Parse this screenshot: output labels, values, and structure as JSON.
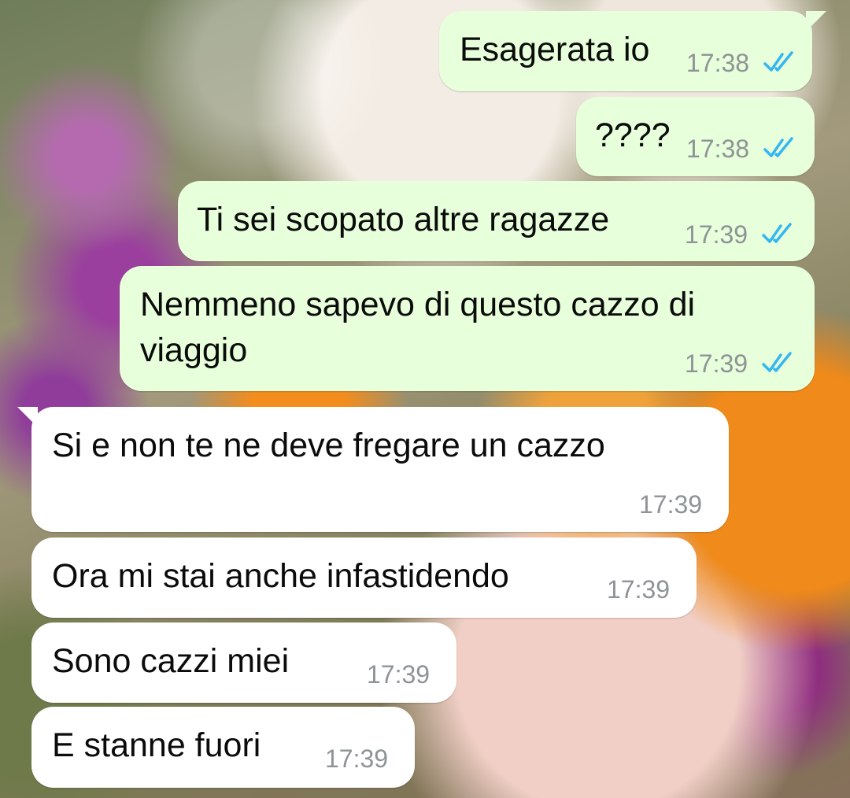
{
  "messages": [
    {
      "direction": "outgoing",
      "text": "Esagerata io",
      "time": "17:38",
      "status": "read"
    },
    {
      "direction": "outgoing",
      "text": "????",
      "time": "17:38",
      "status": "read"
    },
    {
      "direction": "outgoing",
      "text": "Ti sei scopato altre ragazze",
      "time": "17:39",
      "status": "read"
    },
    {
      "direction": "outgoing",
      "line1": "Nemmeno sapevo di questo cazzo di",
      "line2": "viaggio",
      "time": "17:39",
      "status": "read"
    },
    {
      "direction": "incoming",
      "text": "Si e non te ne deve fregare un cazzo",
      "time": "17:39"
    },
    {
      "direction": "incoming",
      "text": "Ora mi stai anche infastidendo",
      "time": "17:39"
    },
    {
      "direction": "incoming",
      "text": "Sono cazzi miei",
      "time": "17:39"
    },
    {
      "direction": "incoming",
      "text": "E stanne fuori",
      "time": "17:39"
    }
  ],
  "colors": {
    "outgoing_bubble": "#e7ffdb",
    "incoming_bubble": "#ffffff",
    "read_ticks": "#34b7f1",
    "timestamp": "#8e9396"
  },
  "icons": {
    "read_status": "double-check-icon"
  }
}
